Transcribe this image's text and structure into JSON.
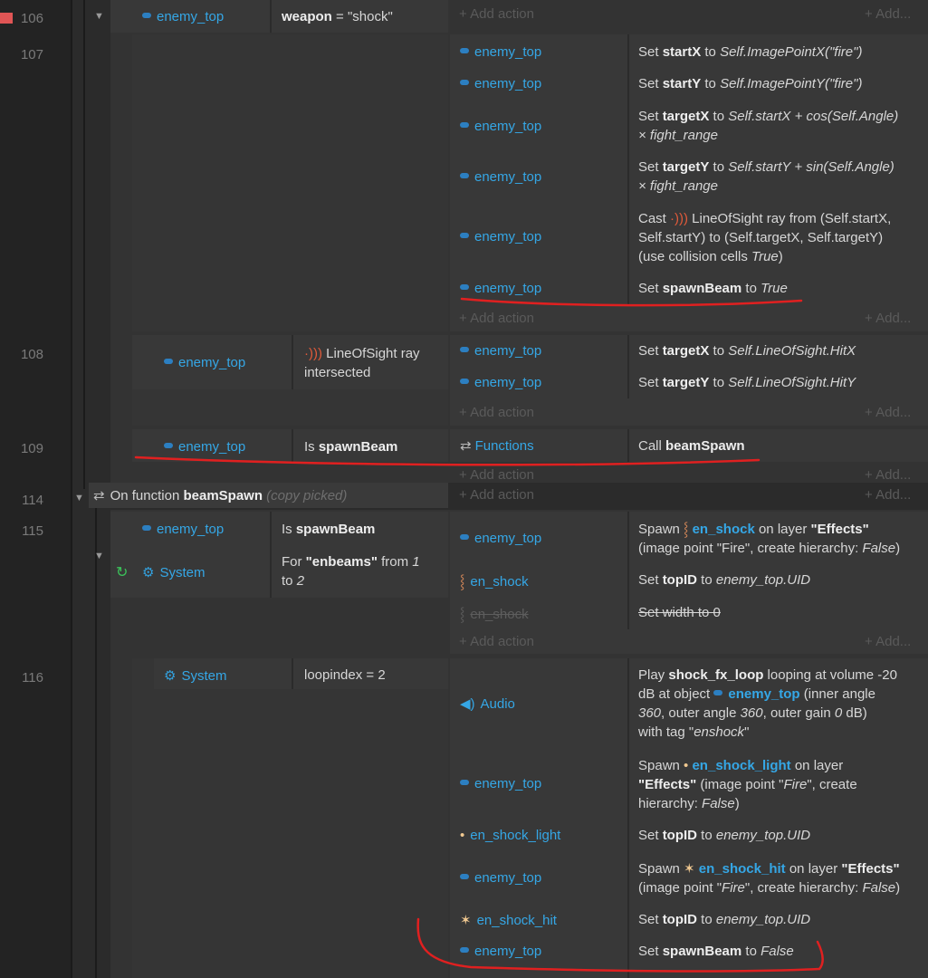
{
  "line_numbers": {
    "l106": "106",
    "l107": "107",
    "l108": "108",
    "l109": "109",
    "l114": "114",
    "l115": "115",
    "l116": "116"
  },
  "add_action": "+ Add action",
  "add_more": "+ Add...",
  "ev106": {
    "object": "enemy_top",
    "cond_prefix": "weapon",
    "cond_suffix": " = \"shock\""
  },
  "ev107": {
    "actions": [
      {
        "obj": "enemy_top",
        "t1": "Set ",
        "b": "startX",
        "t2": " to ",
        "i": "Self.ImagePointX(\"fire\")"
      },
      {
        "obj": "enemy_top",
        "t1": "Set ",
        "b": "startY",
        "t2": " to ",
        "i": "Self.ImagePointY(\"fire\")"
      },
      {
        "obj": "enemy_top",
        "t1": "Set ",
        "b": "targetX",
        "t2": " to ",
        "i": "Self.startX + cos(Self.Angle)",
        "i2": "× fight_range"
      },
      {
        "obj": "enemy_top",
        "t1": "Set ",
        "b": "targetY",
        "t2": " to ",
        "i": "Self.startY + sin(Self.Angle)",
        "i2": "× fight_range"
      },
      {
        "obj": "enemy_top",
        "t1": "Cast ",
        "t2": " LineOfSight ray from (Self.startX,",
        "l2": "Self.startY) to (Self.targetX, Self.targetY)",
        "l3": "(use collision cells ",
        "i": "True",
        "l3end": ")"
      },
      {
        "obj": "enemy_top",
        "t1": "Set ",
        "b": "spawnBeam",
        "t2": " to ",
        "i": "True"
      }
    ]
  },
  "ev108": {
    "object": "enemy_top",
    "cond_line1": "LineOfSight ray",
    "cond_line2": "intersected",
    "actions": [
      {
        "obj": "enemy_top",
        "t1": "Set ",
        "b": "targetX",
        "t2": " to ",
        "i": "Self.LineOfSight.HitX"
      },
      {
        "obj": "enemy_top",
        "t1": "Set ",
        "b": "targetY",
        "t2": " to ",
        "i": "Self.LineOfSight.HitY"
      }
    ]
  },
  "ev109": {
    "object": "enemy_top",
    "cond_prefix": "Is ",
    "cond_bold": "spawnBeam",
    "action_obj": "Functions",
    "action_prefix": "Call ",
    "action_bold": "beamSpawn"
  },
  "ev114": {
    "prefix": "On function ",
    "bold": "beamSpawn",
    "suffix": " (copy picked)"
  },
  "ev115": {
    "cond1_obj": "enemy_top",
    "cond1_prefix": "Is ",
    "cond1_bold": "spawnBeam",
    "cond2_obj": "System",
    "cond2_prefix": "For ",
    "cond2_bold": "\"enbeams\"",
    "cond2_mid": " from ",
    "cond2_i1": "1",
    "cond2_line2": "to ",
    "cond2_i2": "2",
    "actions": [
      {
        "obj": "enemy_top",
        "l1a": "Spawn ",
        "l1b": "en_shock",
        "l1c": " on layer ",
        "l1d": "\"Effects\"",
        "l2a": "(image point \"Fire\", create hierarchy: ",
        "l2b": "False",
        "l2c": ")"
      },
      {
        "obj": "en_shock",
        "t1": "Set ",
        "b": "topID",
        "t2": " to ",
        "i": "enemy_top.UID"
      },
      {
        "obj": "en_shock",
        "text": "Set width to 0"
      }
    ]
  },
  "ev116": {
    "cond_obj": "System",
    "cond_text": "loopindex = 2",
    "actions": [
      {
        "obj": "Audio",
        "l1a": "Play ",
        "l1b": "shock_fx_loop",
        "l1c": " looping at volume -20",
        "l2a": "dB at object ",
        "l2b": "enemy_top",
        "l2c": " (inner angle",
        "l3a": "360",
        "l3b": ", outer angle ",
        "l3c": "360",
        "l3d": ", outer gain ",
        "l3e": "0",
        "l3f": " dB)",
        "l4a": "with tag \"",
        "l4b": "enshock",
        "l4c": "\""
      },
      {
        "obj": "enemy_top",
        "l1a": "Spawn ",
        "l1b": "en_shock_light",
        "l1c": " on layer",
        "l2a": "\"Effects\"",
        "l2b": " (image point \"",
        "l2c": "Fire",
        "l2d": "\", create",
        "l3a": "hierarchy: ",
        "l3b": "False",
        "l3c": ")"
      },
      {
        "obj": "en_shock_light",
        "t1": "Set ",
        "b": "topID",
        "t2": " to ",
        "i": "enemy_top.UID"
      },
      {
        "obj": "enemy_top",
        "l1a": "Spawn ",
        "l1b": "en_shock_hit",
        "l1c": " on layer ",
        "l1d": "\"Effects\"",
        "l2a": "(image point \"",
        "l2b": "Fire",
        "l2c": "\", create hierarchy: ",
        "l2d": "False",
        "l2e": ")"
      },
      {
        "obj": "en_shock_hit",
        "t1": "Set ",
        "b": "topID",
        "t2": " to ",
        "i": "enemy_top.UID"
      },
      {
        "obj": "enemy_top",
        "t1": "Set ",
        "b": "spawnBeam",
        "t2": " to ",
        "i": "False"
      }
    ]
  },
  "colors": {
    "accent": "#35a7e6",
    "annotation": "#e02020",
    "bookmark": "#e05555",
    "background": "#2b2b2b"
  }
}
